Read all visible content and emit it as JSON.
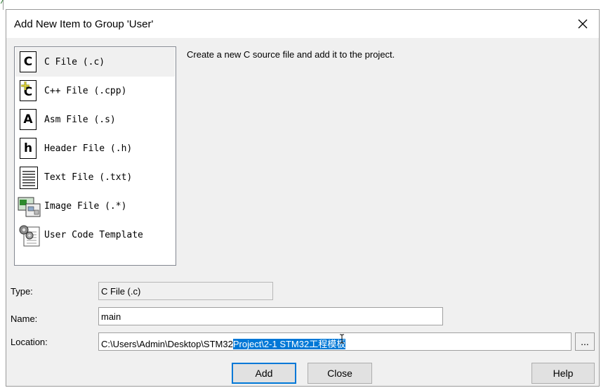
{
  "editor_fragment": "/**",
  "dialog": {
    "title": "Add New Item to Group 'User'",
    "close_glyph": "×"
  },
  "file_types": [
    {
      "label": "C File (.c)",
      "icon": "c-file-icon",
      "glyph": "C",
      "selected": true
    },
    {
      "label": "C++ File (.cpp)",
      "icon": "cpp-file-icon",
      "glyph": "C"
    },
    {
      "label": "Asm File (.s)",
      "icon": "asm-file-icon",
      "glyph": "A"
    },
    {
      "label": "Header File (.h)",
      "icon": "header-file-icon",
      "glyph": "h"
    },
    {
      "label": "Text File (.txt)",
      "icon": "text-file-icon"
    },
    {
      "label": "Image File (.*)",
      "icon": "image-file-icon"
    },
    {
      "label": "User Code Template",
      "icon": "user-code-template-icon"
    }
  ],
  "description": "Create a new C source file and add it to the project.",
  "form": {
    "type_label": "Type:",
    "type_value": "C File (.c)",
    "name_label": "Name:",
    "name_value": "main",
    "location_label": "Location:",
    "location_value_plain": "C:\\Users\\Admin\\Desktop\\STM32",
    "location_value_selected": "Project\\2-1 STM32工程模板",
    "browse_label": "..."
  },
  "buttons": {
    "add": "Add",
    "close": "Close",
    "help": "Help"
  },
  "colors": {
    "selection": "#0078d7",
    "dialog_bg": "#f0f0f0"
  }
}
